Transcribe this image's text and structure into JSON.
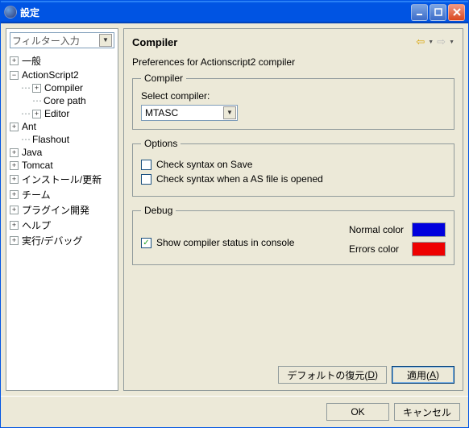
{
  "window": {
    "title": "設定"
  },
  "filter": {
    "placeholder": "フィルター入力"
  },
  "tree": {
    "general": "一般",
    "actionscript2": "ActionScript2",
    "compiler": "Compiler",
    "core_path": "Core path",
    "editor": "Editor",
    "ant": "Ant",
    "flashout": "Flashout",
    "java": "Java",
    "tomcat": "Tomcat",
    "install_update": "インストール/更新",
    "team": "チーム",
    "plugin_dev": "プラグイン開発",
    "help": "ヘルプ",
    "run_debug": "実行/デバッグ"
  },
  "page": {
    "title": "Compiler",
    "subtitle": "Preferences for Actionscript2 compiler",
    "compiler_group": "Compiler",
    "select_compiler": "Select compiler:",
    "compiler_value": "MTASC",
    "options_group": "Options",
    "check_on_save": "Check syntax on Save",
    "check_on_open": "Check syntax when a AS file is opened",
    "debug_group": "Debug",
    "show_compiler_status": "Show compiler status in console",
    "normal_color": "Normal color",
    "errors_color": "Errors color"
  },
  "buttons": {
    "restore": "デフォルトの復元(",
    "restore_u": "D",
    "restore_end": ")",
    "apply": "適用(",
    "apply_u": "A",
    "apply_end": ")",
    "ok": "OK",
    "cancel": "キャンセル"
  }
}
